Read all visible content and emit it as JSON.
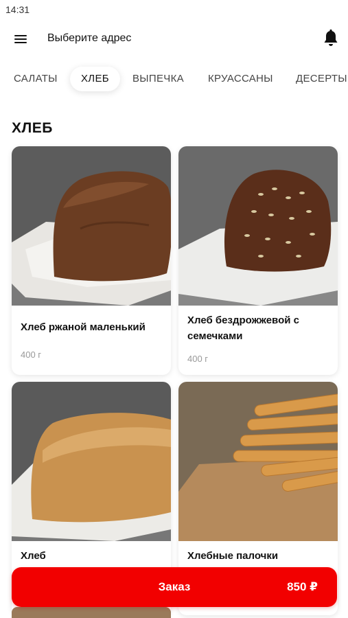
{
  "status_bar": {
    "time": "14:31"
  },
  "header": {
    "address_label": "Выберите адрес",
    "menu_icon": "hamburger-menu-icon",
    "bell_icon": "bell-icon"
  },
  "tabs": [
    {
      "label": "САЛАТЫ",
      "active": false
    },
    {
      "label": "ХЛЕБ",
      "active": true
    },
    {
      "label": "ВЫПЕЧКА",
      "active": false
    },
    {
      "label": "КРУАССАНЫ",
      "active": false
    },
    {
      "label": "ДЕСЕРТЫ",
      "active": false
    }
  ],
  "section": {
    "title": "ХЛЕБ"
  },
  "products": [
    {
      "name": "Хлеб ржаной маленький",
      "weight": "400 г"
    },
    {
      "name": "Хлеб бездрожжевой с семечками",
      "weight": "400 г"
    },
    {
      "name": "Хлеб"
    },
    {
      "name": "Хлебные палочки"
    }
  ],
  "order": {
    "label": "Заказ",
    "price": "850 ₽"
  },
  "colors": {
    "accent": "#f20000",
    "text": "#111111",
    "muted": "#999999"
  }
}
